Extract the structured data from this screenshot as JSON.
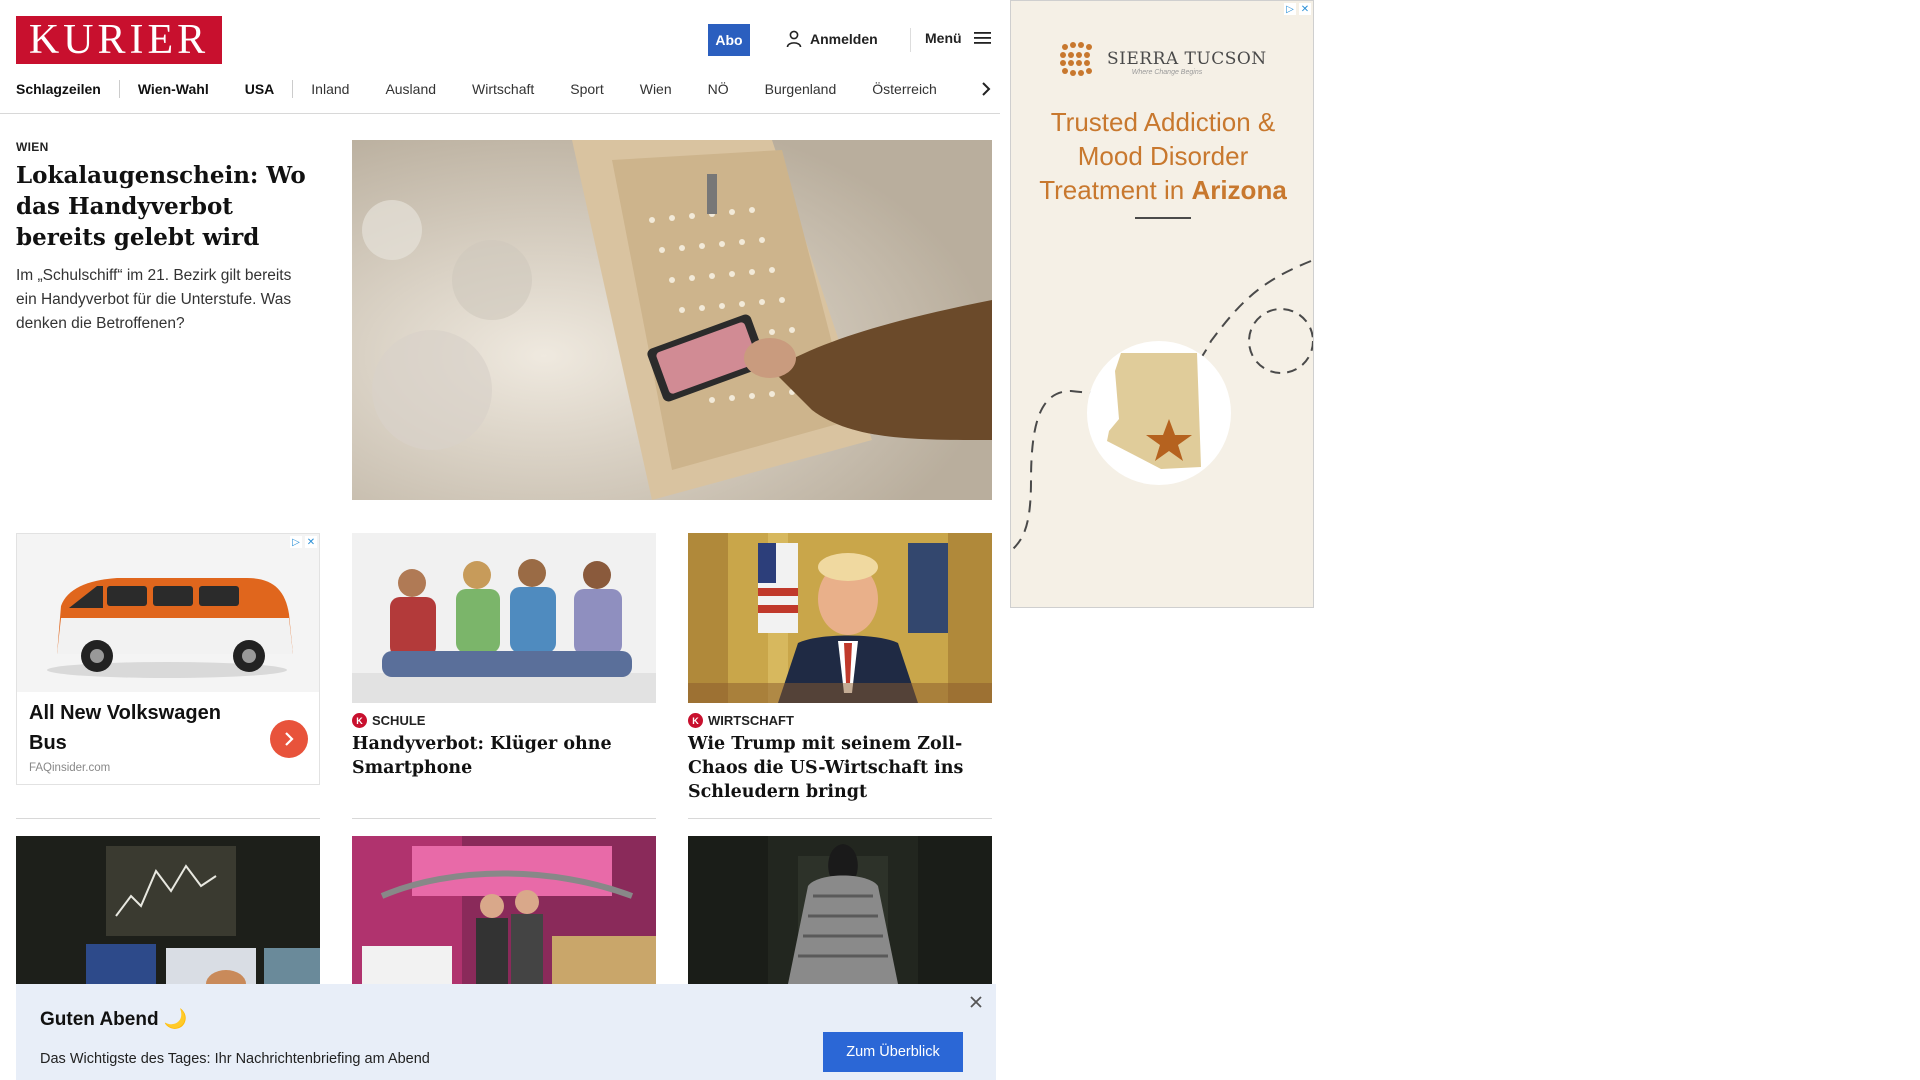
{
  "header": {
    "logo_text": "KURIER",
    "abo_label": "Abo",
    "login_label": "Anmelden",
    "menu_label": "Menü"
  },
  "nav": {
    "items": [
      "Schlagzeilen",
      "Wien-Wahl",
      "USA",
      "Inland",
      "Ausland",
      "Wirtschaft",
      "Sport",
      "Wien",
      "NÖ",
      "Burgenland",
      "Österreich"
    ]
  },
  "lead": {
    "kicker": "WIEN",
    "title": "Lokalaugenschein: Wo das Handyverbot bereits gelebt wird",
    "teaser": "Im „Schulschiff“ im 21. Bezirk gilt bereits ein Handyverbot für die Unterstufe. Was denken die Betroffenen?"
  },
  "ad_vw": {
    "title": "All New Volkswagen Bus",
    "source": "FAQinsider.com"
  },
  "cards": [
    {
      "kicker": "SCHULE",
      "title": "Handyverbot: Klüger ohne Smartphone"
    },
    {
      "kicker": "WIRTSCHAFT",
      "title": "Wie Trump mit seinem Zoll-Chaos die US-Wirtschaft ins Schleudern bringt"
    }
  ],
  "side_ad": {
    "brand": "SIERRA TUCSON",
    "tagline": "Where Change Begins",
    "headline_1": "Trusted Addiction &",
    "headline_2": "Mood Disorder",
    "headline_3": "Treatment in ",
    "headline_em": "Arizona"
  },
  "notice": {
    "greeting": "Guten Abend 🌙",
    "subtitle": "Das Wichtigste des Tages: Ihr Nachrichtenbriefing am Abend",
    "cta": "Zum Überblick"
  },
  "colors": {
    "brand_red": "#c8102e",
    "accent_blue": "#2b67d6",
    "ad_orange": "#c8782e"
  }
}
